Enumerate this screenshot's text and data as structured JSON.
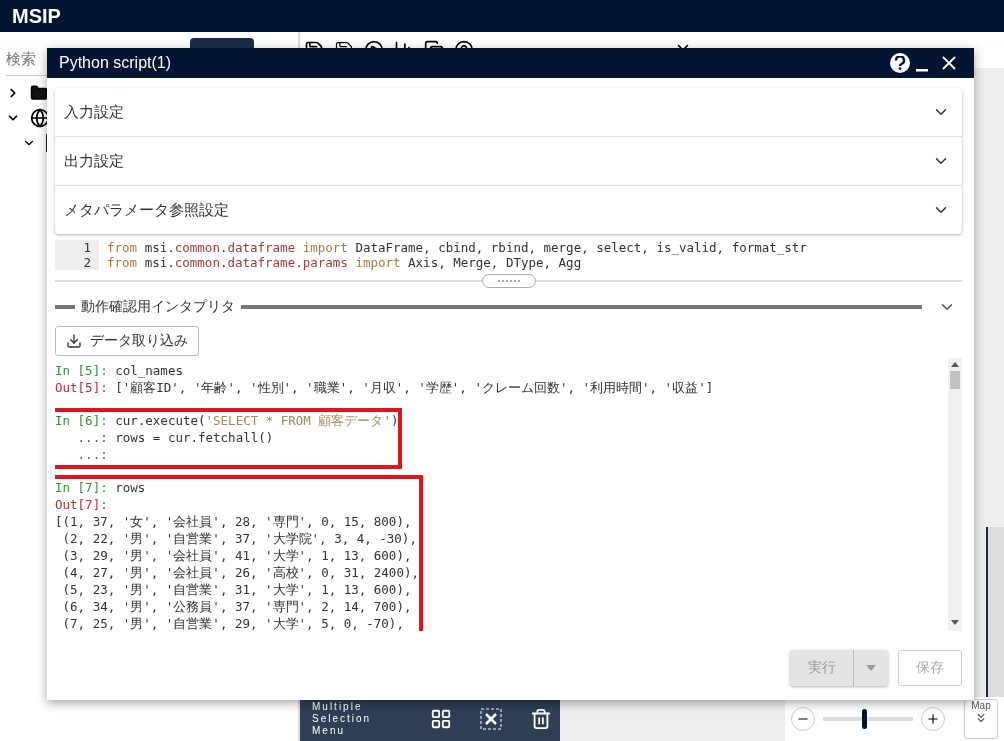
{
  "app": {
    "title": "MSIP"
  },
  "sidebar": {
    "search_label": "検索"
  },
  "selection_menu": {
    "label": "Multiple Selection Menu"
  },
  "zoom": {
    "level": 0.45,
    "map_label": "Map"
  },
  "dialog": {
    "title": "Python script(1)",
    "sections": [
      {
        "label": "入力設定",
        "expanded": false
      },
      {
        "label": "出力設定",
        "expanded": false
      },
      {
        "label": "メタパラメータ参照設定",
        "expanded": false
      }
    ],
    "editor": [
      {
        "number": "1",
        "tokens": [
          {
            "text": "from",
            "kind": "keyword"
          },
          {
            "text": " msi.",
            "kind": "plain"
          },
          {
            "text": "common",
            "kind": "module"
          },
          {
            "text": ".",
            "kind": "plain"
          },
          {
            "text": "dataframe",
            "kind": "module"
          },
          {
            "text": " import",
            "kind": "keyword"
          },
          {
            "text": " DataFrame, cbind, rbind, merge, select, is_valid, format_str",
            "kind": "plain"
          }
        ]
      },
      {
        "number": "2",
        "tokens": [
          {
            "text": "from",
            "kind": "keyword"
          },
          {
            "text": " msi.",
            "kind": "plain"
          },
          {
            "text": "common",
            "kind": "module"
          },
          {
            "text": ".",
            "kind": "plain"
          },
          {
            "text": "dataframe",
            "kind": "module"
          },
          {
            "text": ".",
            "kind": "plain"
          },
          {
            "text": "params",
            "kind": "module"
          },
          {
            "text": " import",
            "kind": "keyword"
          },
          {
            "text": " Axis, Merge, DType, Agg",
            "kind": "plain"
          }
        ]
      }
    ],
    "interpreter_title": "動作確認用インタプリタ",
    "import_button": "データ取り込み",
    "console": [
      {
        "highlighted": false,
        "lines": [
          {
            "kind": "in",
            "prompt": "In [5]: ",
            "tokens": [
              {
                "text": "col_names",
                "kind": "plain"
              }
            ]
          },
          {
            "kind": "out",
            "prompt": "Out[5]: ",
            "tokens": [
              {
                "text": "['顧客ID', '年齢', '性別', '職業', '月収', '学歴', 'クレーム回数', '利用時間', '収益']",
                "kind": "plain"
              }
            ]
          }
        ]
      },
      {
        "highlighted": true,
        "lines": [
          {
            "kind": "in",
            "prompt": "In [6]: ",
            "tokens": [
              {
                "text": "cur.execute(",
                "kind": "plain"
              },
              {
                "text": "'SELECT * FROM 顧客データ'",
                "kind": "string"
              },
              {
                "text": ")",
                "kind": "plain"
              }
            ]
          },
          {
            "kind": "cont",
            "prompt": "   ...: ",
            "tokens": [
              {
                "text": "rows = cur.fetchall()",
                "kind": "plain"
              }
            ]
          },
          {
            "kind": "cont",
            "prompt": "   ...:"
          }
        ]
      },
      {
        "highlighted": true,
        "lines": [
          {
            "kind": "in",
            "prompt": "In [7]: ",
            "tokens": [
              {
                "text": "rows",
                "kind": "plain"
              }
            ]
          },
          {
            "kind": "out",
            "prompt": "Out[7]:"
          },
          {
            "kind": "text",
            "tokens": [
              {
                "text": "[(1, 37, '女', '会社員', 28, '専門', 0, 15, 800),",
                "kind": "plain"
              }
            ]
          },
          {
            "kind": "text",
            "tokens": [
              {
                "text": " (2, 22, '男', '自営業', 37, '大学院', 3, 4, -30),",
                "kind": "plain"
              }
            ]
          },
          {
            "kind": "text",
            "tokens": [
              {
                "text": " (3, 29, '男', '会社員', 41, '大学', 1, 13, 600),",
                "kind": "plain"
              }
            ]
          },
          {
            "kind": "text",
            "tokens": [
              {
                "text": " (4, 27, '男', '会社員', 26, '高校', 0, 31, 2400),",
                "kind": "plain"
              }
            ]
          },
          {
            "kind": "text",
            "tokens": [
              {
                "text": " (5, 23, '男', '自営業', 31, '大学', 1, 13, 600),",
                "kind": "plain"
              }
            ]
          },
          {
            "kind": "text",
            "tokens": [
              {
                "text": " (6, 34, '男', '公務員', 37, '専門', 2, 14, 700),",
                "kind": "plain"
              }
            ]
          },
          {
            "kind": "text",
            "tokens": [
              {
                "text": " (7, 25, '男', '自営業', 29, '大学', 5, 0, -70),",
                "kind": "plain"
              }
            ]
          }
        ]
      }
    ],
    "buttons": [
      {
        "label": "実行",
        "kind": "split",
        "disabled": true
      },
      {
        "label": "保存",
        "kind": "plain",
        "disabled": true
      }
    ]
  }
}
